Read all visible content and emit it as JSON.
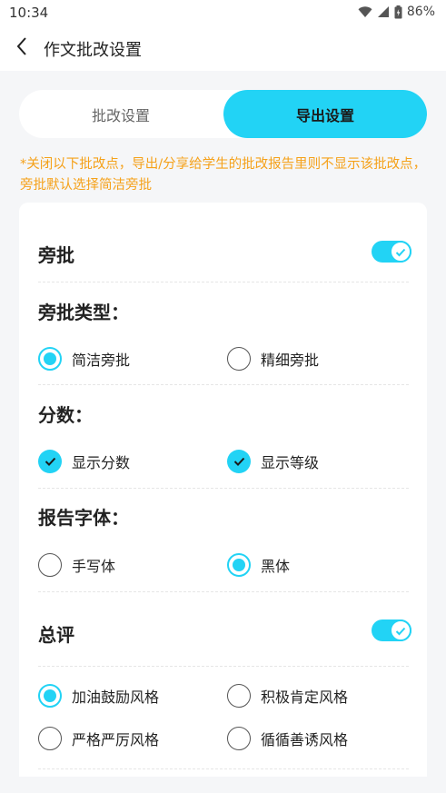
{
  "status": {
    "time": "10:34",
    "battery": "86%"
  },
  "header": {
    "title": "作文批改设置"
  },
  "tabs": [
    {
      "label": "批改设置",
      "selected": false
    },
    {
      "label": "导出设置",
      "selected": true
    }
  ],
  "notice": "*关闭以下批改点，导出/分享给学生的批改报告里则不显示该批改点，旁批默认选择简洁旁批",
  "sections": {
    "side_comment": {
      "title": "旁批",
      "enabled": true
    },
    "side_type": {
      "title": "旁批类型：",
      "options": [
        {
          "label": "简洁旁批",
          "selected": true
        },
        {
          "label": "精细旁批",
          "selected": false
        }
      ]
    },
    "score": {
      "title": "分数：",
      "options": [
        {
          "label": "显示分数",
          "checked": true
        },
        {
          "label": "显示等级",
          "checked": true
        }
      ]
    },
    "font": {
      "title": "报告字体：",
      "options": [
        {
          "label": "手写体",
          "selected": false
        },
        {
          "label": "黑体",
          "selected": true
        }
      ]
    },
    "overall": {
      "title": "总评",
      "enabled": true,
      "options": [
        {
          "label": "加油鼓励风格",
          "selected": true
        },
        {
          "label": "积极肯定风格",
          "selected": false
        },
        {
          "label": "严格严厉风格",
          "selected": false
        },
        {
          "label": "循循善诱风格",
          "selected": false
        }
      ]
    }
  },
  "colors": {
    "accent": "#22d3f5",
    "notice": "#f5a11a",
    "background": "#f5f6f8"
  },
  "icons": [
    "wifi-icon",
    "signal-icon",
    "battery-icon",
    "back-arrow-icon",
    "check-icon"
  ]
}
